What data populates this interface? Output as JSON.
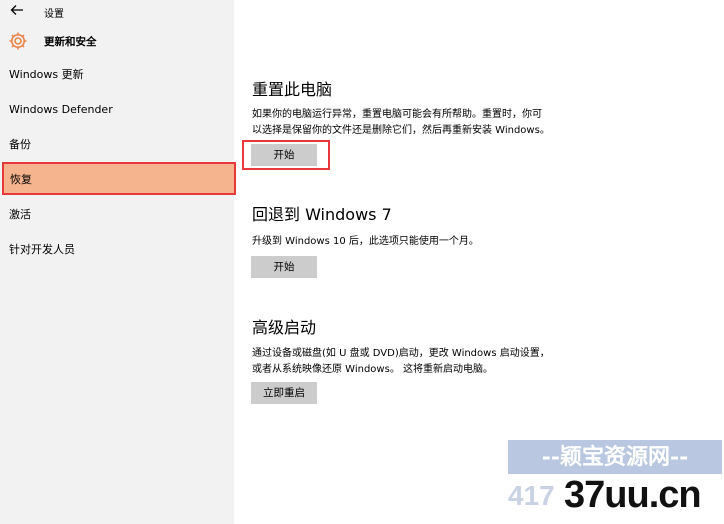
{
  "window": {
    "title": "设置"
  },
  "header": {
    "section_title": "更新和安全"
  },
  "sidebar": {
    "items": [
      {
        "label": "Windows 更新"
      },
      {
        "label": "Windows Defender"
      },
      {
        "label": "备份"
      },
      {
        "label": "恢复",
        "selected": true
      },
      {
        "label": "激活"
      },
      {
        "label": "针对开发人员"
      }
    ]
  },
  "main": {
    "reset": {
      "title": "重置此电脑",
      "desc_line1": "如果你的电脑运行异常，重置电脑可能会有所帮助。重置时，你可",
      "desc_line2": "以选择是保留你的文件还是删除它们，然后再重新安装 Windows。",
      "button": "开始"
    },
    "rollback": {
      "title": "回退到 Windows 7",
      "desc": "升级到 Windows 10 后，此选项只能使用一个月。",
      "button": "开始"
    },
    "advanced": {
      "title": "高级启动",
      "desc_line1": "通过设备或磁盘(如 U 盘或 DVD)启动，更改 Windows 启动设置，",
      "desc_line2": "或者从系统映像还原 Windows。 这将重新启动电脑。",
      "button": "立即重启"
    }
  },
  "watermark": {
    "top": "--颖宝资源网--",
    "num": "417",
    "main": "37uu.cn"
  },
  "colors": {
    "selected_bg": "#f5b48e",
    "highlight_border": "#e5393c",
    "button_bg": "#cccccc"
  }
}
